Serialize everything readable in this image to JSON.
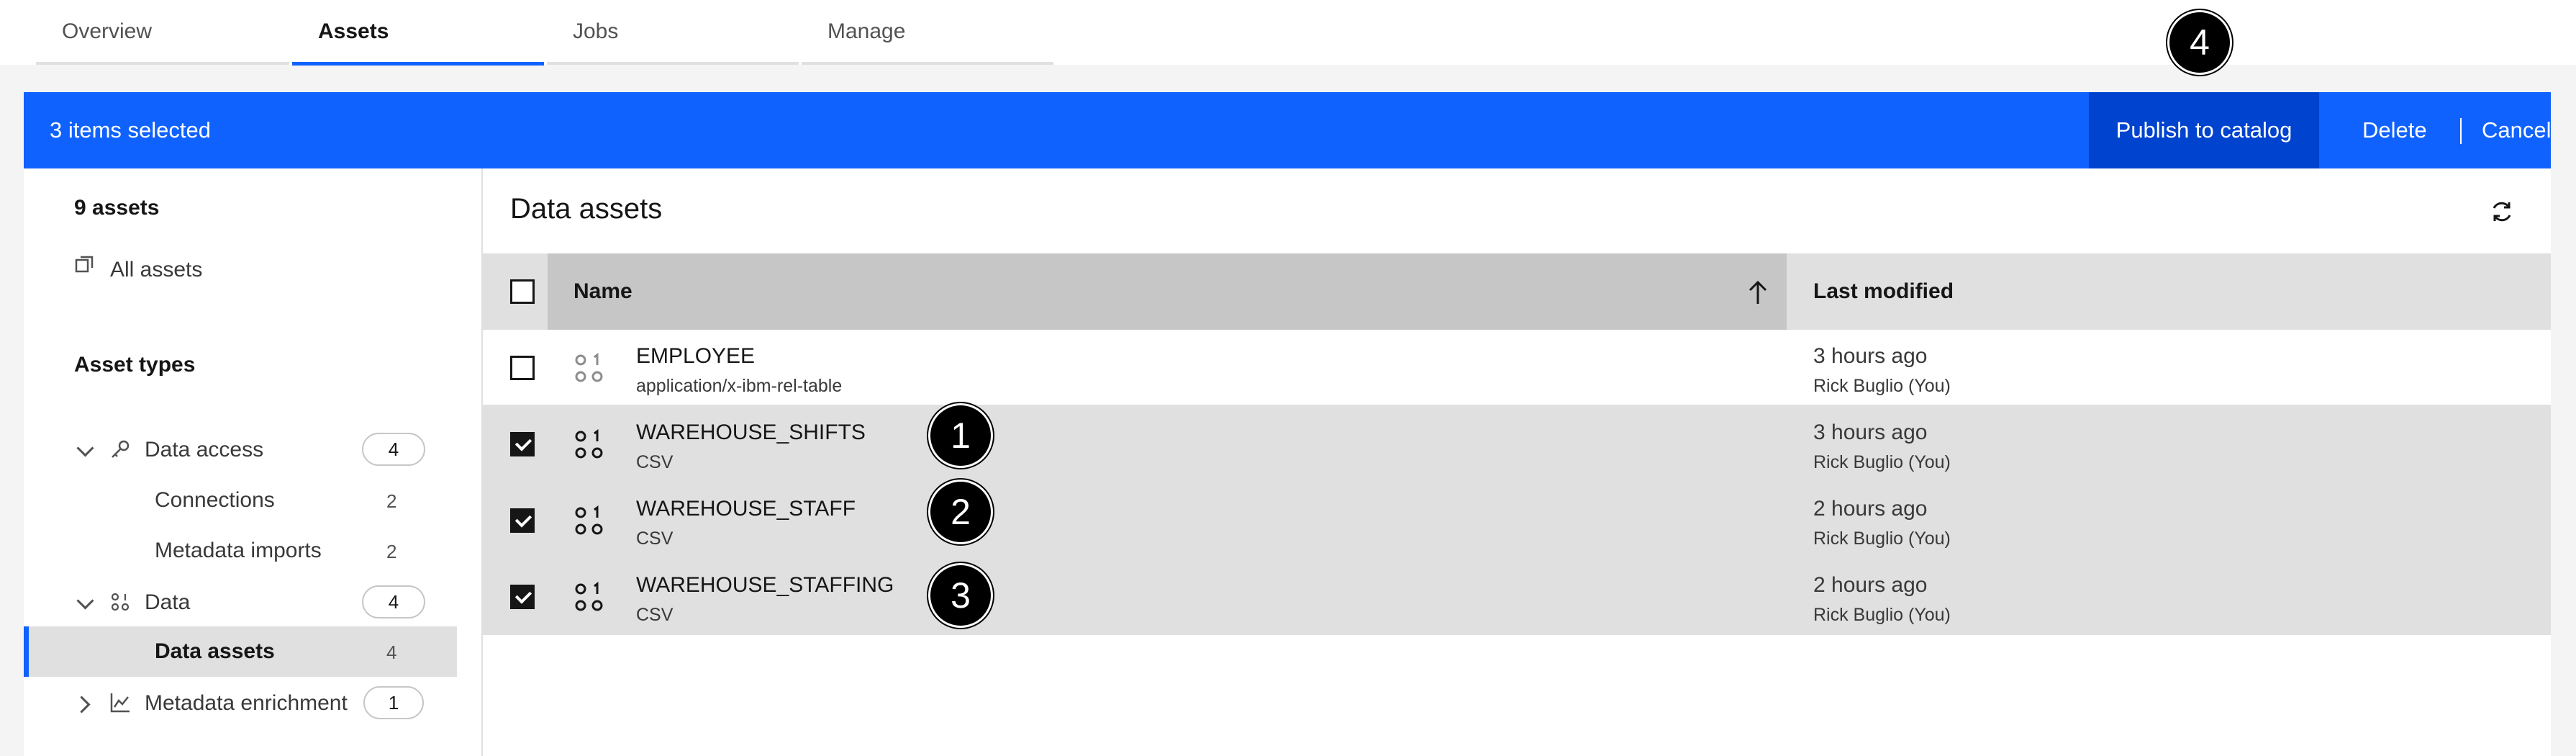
{
  "tabs": [
    "Overview",
    "Assets",
    "Jobs",
    "Manage"
  ],
  "action_bar": {
    "selected_text": "3 items selected",
    "publish": "Publish to catalog",
    "delete": "Delete",
    "cancel": "Cancel"
  },
  "sidebar": {
    "count_title": "9 assets",
    "all_assets": "All assets",
    "asset_types": "Asset types",
    "data_access": {
      "label": "Data access",
      "count": "4"
    },
    "connections": {
      "label": "Connections",
      "count": "2"
    },
    "metadata_imports": {
      "label": "Metadata imports",
      "count": "2"
    },
    "data": {
      "label": "Data",
      "count": "4"
    },
    "data_assets": {
      "label": "Data assets",
      "count": "4"
    },
    "metadata_enrichment": {
      "label": "Metadata enrichment",
      "count": "1"
    }
  },
  "main": {
    "title": "Data assets",
    "columns": {
      "name": "Name",
      "modified": "Last modified"
    },
    "rows": [
      {
        "name": "EMPLOYEE",
        "type": "application/x-ibm-rel-table",
        "modified": "3 hours ago",
        "by": "Rick Buglio (You)"
      },
      {
        "name": "WAREHOUSE_SHIFTS",
        "type": "CSV",
        "modified": "3 hours ago",
        "by": "Rick Buglio (You)"
      },
      {
        "name": "WAREHOUSE_STAFF",
        "type": "CSV",
        "modified": "2 hours ago",
        "by": "Rick Buglio (You)"
      },
      {
        "name": "WAREHOUSE_STAFFING",
        "type": "CSV",
        "modified": "2 hours ago",
        "by": "Rick Buglio (You)"
      }
    ]
  },
  "callouts": [
    "1",
    "2",
    "3",
    "4"
  ],
  "colors": {
    "accent": "#0f62fe",
    "accent_dark": "#0043ce",
    "selected_row": "#e0e0e0"
  }
}
